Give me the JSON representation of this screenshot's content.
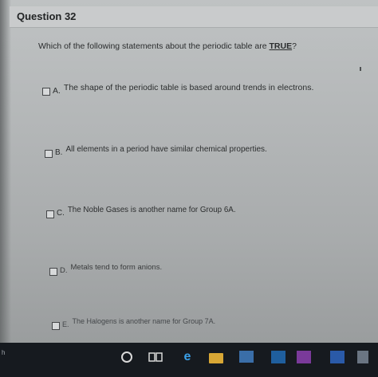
{
  "question": {
    "title": "Question 32",
    "text_before": "Which of the following statements about the periodic table are ",
    "text_emphasis": "TRUE",
    "text_after": "?"
  },
  "options": [
    {
      "letter": "A.",
      "text": "The shape of the periodic table is based around trends in electrons."
    },
    {
      "letter": "B.",
      "text": "All elements in a period have similar chemical properties."
    },
    {
      "letter": "C.",
      "text": "The Noble Gases is another name for Group 6A."
    },
    {
      "letter": "D.",
      "text": "Metals tend to form anions."
    },
    {
      "letter": "E.",
      "text": "The Halogens is another name for Group 7A."
    }
  ],
  "taskbar": {
    "side_label": "h",
    "icons": [
      "cortana-icon",
      "task-view-icon",
      "edge-icon",
      "file-explorer-icon",
      "store-icon",
      "mail-icon",
      "onenote-icon",
      "word-icon",
      "app-icon"
    ],
    "edge_glyph": "e"
  },
  "colors": {
    "page_background": "#b4b7b8",
    "taskbar_background": "#161a1f",
    "edge_blue": "#3aa0e8"
  }
}
